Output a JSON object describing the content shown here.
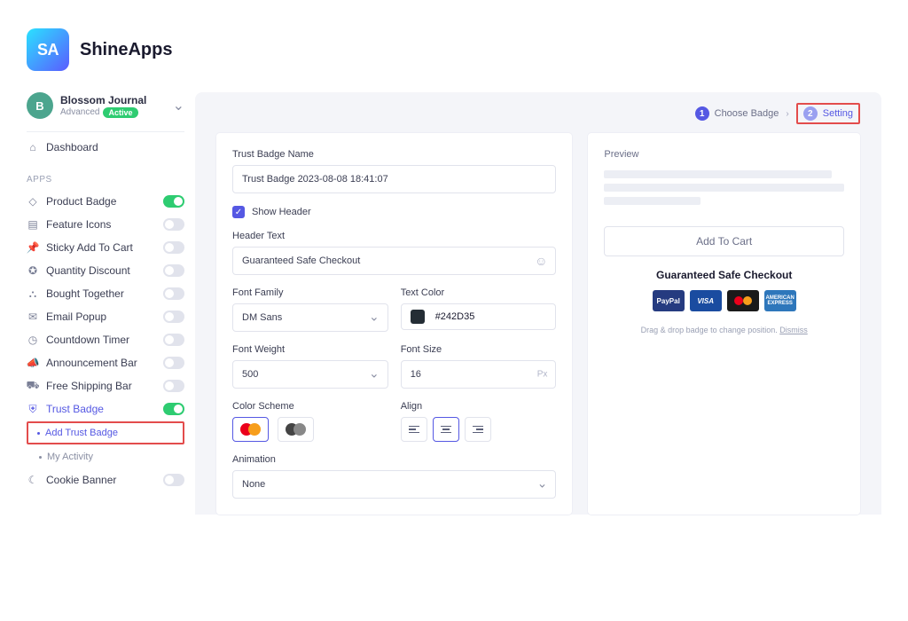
{
  "brand": "ShineApps",
  "logo_letters": "SA",
  "account": {
    "initial": "B",
    "name": "Blossom Journal",
    "plan": "Advanced",
    "status": "Active"
  },
  "nav": {
    "dashboard": "Dashboard",
    "section_apps": "APPS"
  },
  "apps": [
    {
      "key": "product_badge",
      "label": "Product Badge",
      "on": true
    },
    {
      "key": "feature_icons",
      "label": "Feature Icons",
      "on": false
    },
    {
      "key": "sticky_cart",
      "label": "Sticky Add To Cart",
      "on": false
    },
    {
      "key": "qty_discount",
      "label": "Quantity Discount",
      "on": false
    },
    {
      "key": "bought_together",
      "label": "Bought Together",
      "on": false
    },
    {
      "key": "email_popup",
      "label": "Email Popup",
      "on": false
    },
    {
      "key": "countdown",
      "label": "Countdown Timer",
      "on": false
    },
    {
      "key": "announcement",
      "label": "Announcement Bar",
      "on": false
    },
    {
      "key": "free_shipping",
      "label": "Free Shipping Bar",
      "on": false
    },
    {
      "key": "trust_badge",
      "label": "Trust Badge",
      "on": true,
      "active": true
    },
    {
      "key": "cookie_banner",
      "label": "Cookie Banner",
      "on": false
    }
  ],
  "trust_sub": {
    "add": "Add Trust Badge",
    "activity": "My Activity"
  },
  "stepper": {
    "step1_label": "Choose Badge",
    "step2_label": "Setting"
  },
  "form": {
    "name_label": "Trust Badge Name",
    "name_value": "Trust Badge 2023-08-08 18:41:07",
    "show_header_label": "Show Header",
    "header_text_label": "Header Text",
    "header_text_value": "Guaranteed Safe Checkout",
    "font_family_label": "Font Family",
    "font_family_value": "DM Sans",
    "text_color_label": "Text Color",
    "text_color_value": "#242D35",
    "font_weight_label": "Font Weight",
    "font_weight_value": "500",
    "font_size_label": "Font Size",
    "font_size_value": "16",
    "font_size_unit": "Px",
    "color_scheme_label": "Color Scheme",
    "align_label": "Align",
    "animation_label": "Animation",
    "animation_value": "None"
  },
  "preview": {
    "title": "Preview",
    "add_to_cart": "Add To Cart",
    "gsc": "Guaranteed Safe Checkout",
    "badges": {
      "paypal": "PayPal",
      "visa": "VISA",
      "amex": "AMERICAN EXPRESS"
    },
    "hint_text": "Drag & drop badge to change position. ",
    "hint_link": "Dismiss"
  }
}
